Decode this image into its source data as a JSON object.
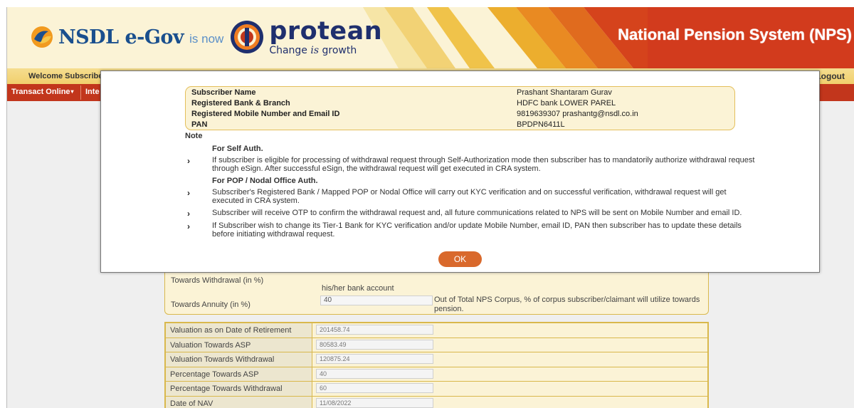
{
  "header": {
    "nsdl_brand": "NSDL e-Gov",
    "is_now": "is now",
    "protean_brand": "protean",
    "tagline_pre": "Change ",
    "tagline_is": "is",
    "tagline_post": " growth",
    "system_title": "National Pension System (NPS)"
  },
  "welcome_bar": {
    "welcome": "Welcome Subscribe",
    "logout": "Logout"
  },
  "menu": {
    "transact": "Transact Online",
    "next_partial": "Inte"
  },
  "modal": {
    "info": [
      {
        "label": "Subscriber Name",
        "value": "Prashant Shantaram Gurav"
      },
      {
        "label": "Registered Bank & Branch",
        "value": "HDFC bank  LOWER PAREL"
      },
      {
        "label": "Registered Mobile Number and Email ID",
        "value": "9819639307  prashantg@nsdl.co.in"
      },
      {
        "label": "PAN",
        "value": "BPDPN6411L"
      }
    ],
    "note_title": "Note",
    "self_auth_head": "For Self Auth.",
    "pop_head": "For POP / Nodal Office Auth.",
    "bullets": [
      "If subscriber is eligible for processing of withdrawal request through Self-Authorization mode then subscriber has to mandatorily authorize withdrawal request through eSign. After successful eSign, the withdrawal request will get executed in CRA system.",
      "Subscriber's Registered Bank / Mapped POP or Nodal Office will carry out KYC verification and on successful verification, withdrawal request will get executed in CRA system.",
      "Subscriber will receive OTP to confirm the withdrawal request and, all future communications related to NPS will be sent on Mobile Number and email ID.",
      "If Subscriber wish to change its Tier-1 Bank for KYC verification and/or update Mobile Number, email ID, PAN then subscriber has to update these details before initiating withdrawal request."
    ],
    "ok_label": "OK"
  },
  "form": {
    "withdrawal_label": "Towards Withdrawal (in %)",
    "withdrawal_note_tail": "his/her bank account",
    "annuity_label": "Towards Annuity (in %)",
    "annuity_value": "40",
    "annuity_note": "Out of Total NPS Corpus, % of corpus subscriber/claimant will utilize towards pension."
  },
  "valuation": [
    {
      "label": "Valuation as on Date of Retirement",
      "value": "201458.74"
    },
    {
      "label": "Valuation Towards ASP",
      "value": "80583.49"
    },
    {
      "label": "Valuation Towards Withdrawal",
      "value": "120875.24"
    },
    {
      "label": "Percentage Towards ASP",
      "value": "40"
    },
    {
      "label": "Percentage Towards Withdrawal",
      "value": "60"
    },
    {
      "label": "Date of NAV",
      "value": "11/08/2022"
    }
  ],
  "colors": {
    "menu_red": "#c2361c",
    "header_cream": "#fbf3d6",
    "ok_orange": "#d9692c",
    "border_gold": "#d9b84c"
  }
}
